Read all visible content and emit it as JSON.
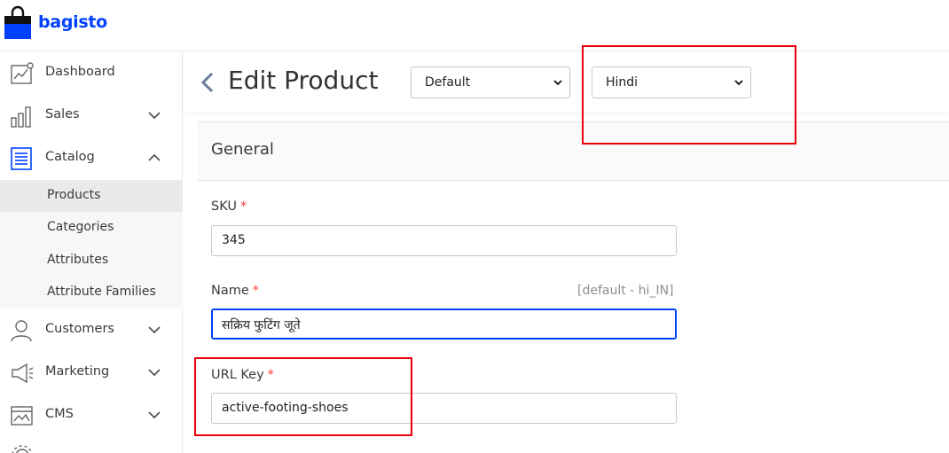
{
  "app": {
    "logo_text": "bagisto",
    "brand_color": "#0041ff"
  },
  "sidebar": {
    "items": [
      {
        "label": "Dashboard",
        "icon": "dashboard-icon"
      },
      {
        "label": "Sales",
        "icon": "sales-chart-icon",
        "chevron": "chevron-down-icon"
      },
      {
        "label": "Catalog",
        "icon": "catalog-icon",
        "chevron": "chevron-up-icon",
        "expanded": true
      },
      {
        "label": "Customers",
        "icon": "customers-icon",
        "chevron": "chevron-down-icon"
      },
      {
        "label": "Marketing",
        "icon": "megaphone-icon",
        "chevron": "chevron-down-icon"
      },
      {
        "label": "CMS",
        "icon": "cms-icon",
        "chevron": "chevron-down-icon"
      }
    ],
    "catalog_submenu": [
      {
        "label": "Products",
        "active": true
      },
      {
        "label": "Categories"
      },
      {
        "label": "Attributes"
      },
      {
        "label": "Attribute Families"
      }
    ]
  },
  "header": {
    "title": "Edit Product",
    "channel_select": {
      "value": "Default"
    },
    "locale_select": {
      "value": "Hindi"
    }
  },
  "form": {
    "section_title": "General",
    "sku": {
      "label": "SKU",
      "required_mark": "*",
      "value": "345"
    },
    "name": {
      "label": "Name",
      "required_mark": "*",
      "note": "[default - hi_IN]",
      "value": "सक्रिय फुटिंग जूते"
    },
    "url_key": {
      "label": "URL Key",
      "required_mark": "*",
      "value": "active-footing-shoes"
    }
  },
  "colors": {
    "annotation": "#e8000b",
    "required": "#fc3d3d",
    "focus": "#0041ff"
  }
}
